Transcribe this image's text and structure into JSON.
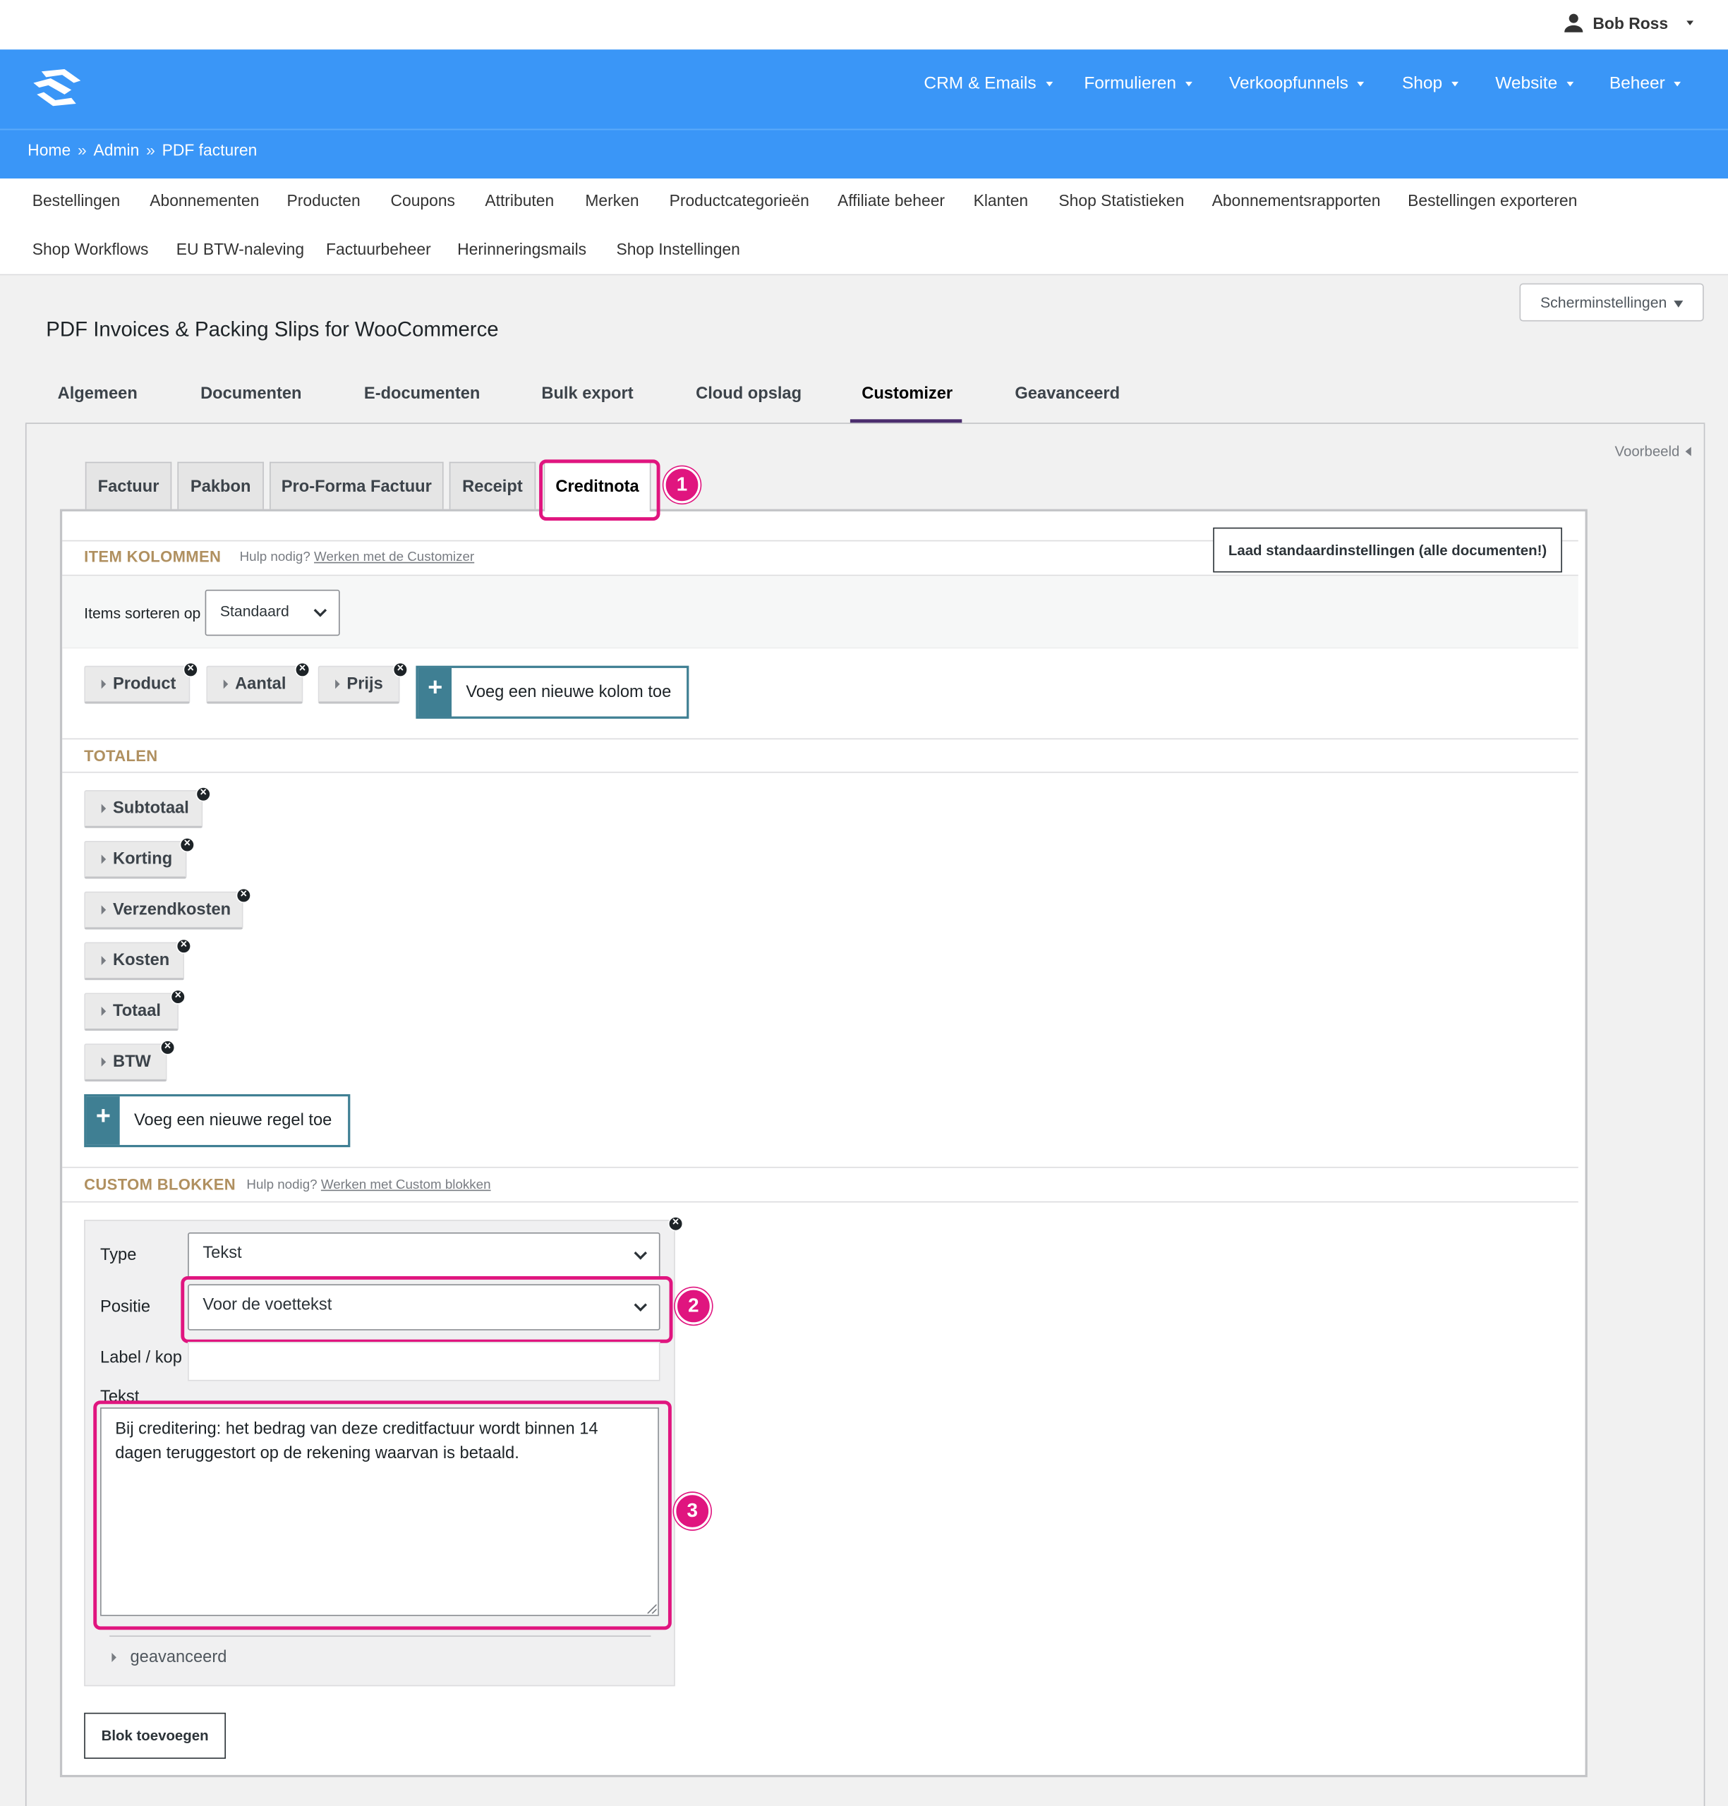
{
  "user": {
    "name": "Bob Ross"
  },
  "nav": {
    "items": [
      "CRM & Emails",
      "Formulieren",
      "Verkoopfunnels",
      "Shop",
      "Website",
      "Beheer"
    ]
  },
  "breadcrumb": {
    "home": "Home",
    "sep": "»",
    "admin": "Admin",
    "current": "PDF facturen"
  },
  "submenu": {
    "row1": [
      "Bestellingen",
      "Abonnementen",
      "Producten",
      "Coupons",
      "Attributen",
      "Merken",
      "Productcategorieën",
      "Affiliate beheer",
      "Klanten",
      "Shop Statistieken",
      "Abonnementsrapporten",
      "Bestellingen exporteren"
    ],
    "row2": [
      "Shop Workflows",
      "EU BTW-naleving",
      "Factuurbeheer",
      "Herinneringsmails",
      "Shop Instellingen"
    ]
  },
  "screen_options": "Scherminstellingen",
  "page_title": "PDF Invoices & Packing Slips for WooCommerce",
  "tabs": [
    "Algemeen",
    "Documenten",
    "E-documenten",
    "Bulk export",
    "Cloud opslag",
    "Customizer",
    "Geavanceerd"
  ],
  "active_tab": "Customizer",
  "preview": "Voorbeeld",
  "doc_tabs": [
    "Factuur",
    "Pakbon",
    "Pro-Forma Factuur",
    "Receipt",
    "Creditnota"
  ],
  "active_doc_tab": "Creditnota",
  "annotations": {
    "one": "1",
    "two": "2",
    "three": "3"
  },
  "accent_colors": {
    "nav": "#3a96f7",
    "highlight": "#e0157f",
    "section_heading": "#b09060",
    "add_button": "#3f7f93"
  },
  "item_columns": {
    "heading": "ITEM KOLOMMEN",
    "help_prefix": "Hulp nodig?",
    "help_link": "Werken met de Customizer",
    "reset_button": "Laad standaardinstellingen (alle documenten!)",
    "sort_label": "Items sorteren op",
    "sort_value": "Standaard",
    "columns": [
      "Product",
      "Aantal",
      "Prijs"
    ],
    "add_placeholder": "Voeg een nieuwe kolom toe"
  },
  "totals": {
    "heading": "TOTALEN",
    "rows": [
      "Subtotaal",
      "Korting",
      "Verzendkosten",
      "Kosten",
      "Totaal",
      "BTW"
    ],
    "add_placeholder": "Voeg een nieuwe regel toe"
  },
  "custom_blocks": {
    "heading": "CUSTOM BLOKKEN",
    "help_prefix": "Hulp nodig?",
    "help_link": "Werken met Custom blokken",
    "type_label": "Type",
    "type_value": "Tekst",
    "position_label": "Positie",
    "position_value": "Voor de voettekst",
    "label_label": "Label / kop",
    "label_value": "",
    "text_label": "Tekst",
    "text_value": "Bij creditering: het bedrag van deze creditfactuur wordt binnen 14 dagen teruggestort op de rekening waarvan is betaald.",
    "advanced": "geavanceerd",
    "add_block_button": "Blok toevoegen"
  }
}
